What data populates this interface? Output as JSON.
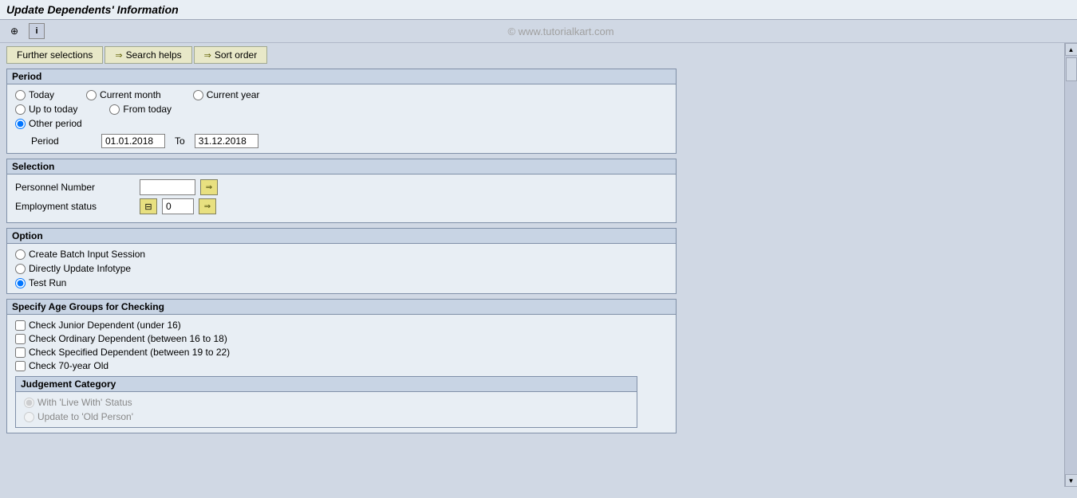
{
  "title": "Update Dependents' Information",
  "watermark": "© www.tutorialkart.com",
  "tabs": [
    {
      "label": "Further selections",
      "has_arrow": true
    },
    {
      "label": "Search helps",
      "has_arrow": true
    },
    {
      "label": "Sort order",
      "has_arrow": true
    }
  ],
  "period_section": {
    "header": "Period",
    "options": [
      {
        "label": "Today",
        "name": "period",
        "value": "today"
      },
      {
        "label": "Current month",
        "name": "period",
        "value": "current_month"
      },
      {
        "label": "Current year",
        "name": "period",
        "value": "current_year"
      },
      {
        "label": "Up to today",
        "name": "period",
        "value": "up_to_today"
      },
      {
        "label": "From today",
        "name": "period",
        "value": "from_today"
      },
      {
        "label": "Other period",
        "name": "period",
        "value": "other_period",
        "checked": true
      }
    ],
    "period_from_label": "Period",
    "period_from_value": "01.01.2018",
    "period_to_label": "To",
    "period_to_value": "31.12.2018"
  },
  "selection_section": {
    "header": "Selection",
    "personnel_number_label": "Personnel Number",
    "personnel_number_value": "",
    "employment_status_label": "Employment status",
    "employment_status_value": "0"
  },
  "option_section": {
    "header": "Option",
    "options": [
      {
        "label": "Create Batch Input Session",
        "name": "option",
        "value": "batch"
      },
      {
        "label": "Directly Update Infotype",
        "name": "option",
        "value": "direct"
      },
      {
        "label": "Test Run",
        "name": "option",
        "value": "test",
        "checked": true
      }
    ]
  },
  "age_groups_section": {
    "header": "Specify Age Groups for Checking",
    "checkboxes": [
      {
        "label": "Check Junior Dependent (under 16)",
        "checked": false
      },
      {
        "label": "Check Ordinary Dependent (between 16 to 18)",
        "checked": false
      },
      {
        "label": "Check Specified Dependent (between 19 to 22)",
        "checked": false
      },
      {
        "label": "Check 70-year Old",
        "checked": false
      }
    ],
    "judgement_section": {
      "header": "Judgement Category",
      "options": [
        {
          "label": "With 'Live With' Status",
          "name": "judgement",
          "value": "live_with",
          "checked": true,
          "disabled": true
        },
        {
          "label": "Update to 'Old Person'",
          "name": "judgement",
          "value": "old_person",
          "disabled": true
        }
      ]
    }
  }
}
